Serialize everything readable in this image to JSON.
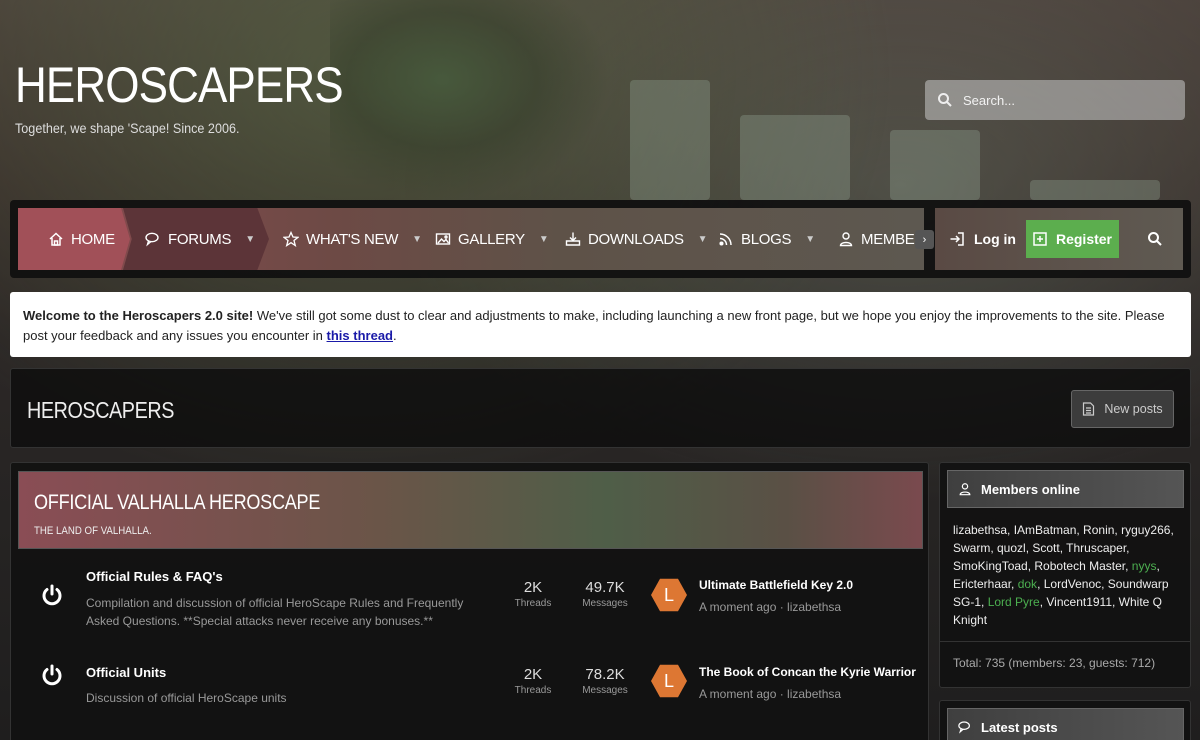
{
  "site": {
    "title": "HEROSCAPERS",
    "tagline": "Together, we shape 'Scape! Since 2006."
  },
  "search": {
    "placeholder": "Search..."
  },
  "nav": {
    "items": [
      {
        "label": "Home",
        "icon": "home-icon"
      },
      {
        "label": "Forums",
        "icon": "comments-icon"
      },
      {
        "label": "What's new",
        "icon": "star-icon"
      },
      {
        "label": "Gallery",
        "icon": "image-icon"
      },
      {
        "label": "Downloads",
        "icon": "download-icon"
      },
      {
        "label": "Blogs",
        "icon": "rss-icon"
      },
      {
        "label": "Members",
        "icon": "user-icon"
      }
    ],
    "login": "Log in",
    "register": "Register"
  },
  "notice": {
    "bold": "Welcome to the Heroscapers 2.0 site!",
    "text": " We've still got some dust to clear and adjustments to make, including launching a new front page, but we hope you enjoy the improvements to the site. Please post your feedback and any issues you encounter in ",
    "link": "this thread",
    "end": "."
  },
  "page": {
    "title": "HEROSCAPERS",
    "new_posts": "New posts"
  },
  "category": {
    "title": "Official Valhalla Heroscape",
    "description": "The land of Valhalla.",
    "forums": [
      {
        "name": "Official Rules & FAQ's",
        "description": "Compilation and discussion of official HeroScape Rules and Frequently Asked Questions. **Special attacks never receive any bonuses.**",
        "threads": "2K",
        "threads_label": "Threads",
        "messages": "49.7K",
        "messages_label": "Messages",
        "avatar_letter": "L",
        "latest_title": "Ultimate Battlefield Key 2.0",
        "latest_meta": "A moment ago · lizabethsa"
      },
      {
        "name": "Official Units",
        "description": "Discussion of official HeroScape units",
        "threads": "2K",
        "threads_label": "Threads",
        "messages": "78.2K",
        "messages_label": "Messages",
        "avatar_letter": "L",
        "latest_title": "The Book of Concan the Kyrie Warrior",
        "latest_meta": "A moment ago · lizabethsa"
      }
    ]
  },
  "members_online": {
    "title": "Members online",
    "names_part1": "lizabethsa, IAmBatman, Ronin, ryguy266, Swarm, quozl, Scott, Thruscaper, SmoKingToad, Robotech Master, ",
    "green1": "nyys",
    "names_part2": ", Ericterhaar, ",
    "green2": "dok",
    "names_part3": ", LordVenoc, Soundwarp SG-1, ",
    "green3": "Lord Pyre",
    "names_part4": ", Vincent1911, White Q Knight",
    "total": "Total: 735 (members: 23, guests: 712)"
  },
  "latest_posts": {
    "title": "Latest posts"
  },
  "colors": {
    "register": "#5cae4e",
    "avatar": "#dd7733",
    "online_green": "#4caf50"
  }
}
